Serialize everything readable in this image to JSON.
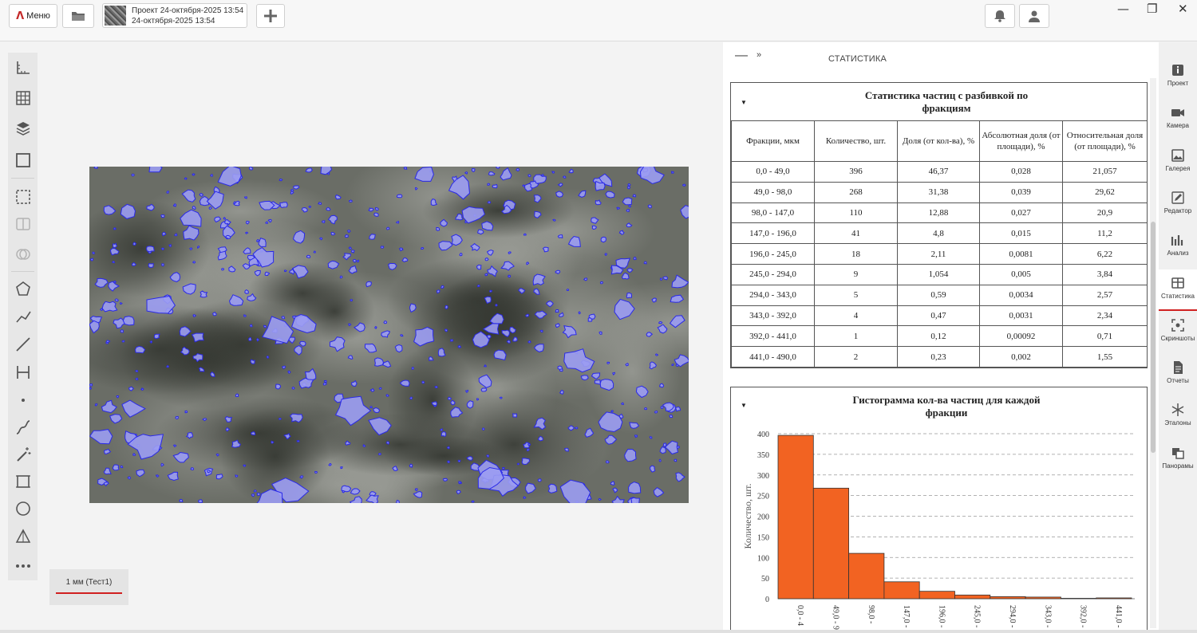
{
  "topbar": {
    "menu_label": "Меню",
    "project_line1": "Проект 24-октября-2025 13:54",
    "project_line2": "24-октября-2025 13:54",
    "icons": [
      "logo-icon",
      "folder-icon",
      "add-icon",
      "bell-icon",
      "user-icon"
    ]
  },
  "scale": {
    "label": "1 мм (Тест1)"
  },
  "panel": {
    "title": "СТАТИСТИКА"
  },
  "stats_table": {
    "title": "Статистика частиц с разбивкой по фракциям",
    "headers": [
      "Фракции, мкм",
      "Количество, шт.",
      "Доля (от кол-ва), %",
      "Абсолютная доля (от площади), %",
      "Относительная доля (от площади), %"
    ],
    "rows": [
      [
        "0,0 - 49,0",
        "396",
        "46,37",
        "0,028",
        "21,057"
      ],
      [
        "49,0 - 98,0",
        "268",
        "31,38",
        "0,039",
        "29,62"
      ],
      [
        "98,0 - 147,0",
        "110",
        "12,88",
        "0,027",
        "20,9"
      ],
      [
        "147,0 - 196,0",
        "41",
        "4,8",
        "0,015",
        "11,2"
      ],
      [
        "196,0 - 245,0",
        "18",
        "2,11",
        "0,0081",
        "6,22"
      ],
      [
        "245,0 - 294,0",
        "9",
        "1,054",
        "0,005",
        "3,84"
      ],
      [
        "294,0 - 343,0",
        "5",
        "0,59",
        "0,0034",
        "2,57"
      ],
      [
        "343,0 - 392,0",
        "4",
        "0,47",
        "0,0031",
        "2,34"
      ],
      [
        "392,0 - 441,0",
        "1",
        "0,12",
        "0,00092",
        "0,71"
      ],
      [
        "441,0 - 490,0",
        "2",
        "0,23",
        "0,002",
        "1,55"
      ]
    ]
  },
  "chart_data": {
    "type": "bar",
    "title": "Гистограмма кол-ва частиц для каждой фракции",
    "ylabel": "Количество, шт.",
    "xlabel": "",
    "categories": [
      "0,0 - 4",
      "49,0 - 9",
      "98,0 -",
      "147,0 -",
      "196,0 -",
      "245,0 -",
      "294,0 -",
      "343,0 -",
      "392,0 -",
      "441,0 -"
    ],
    "values": [
      396,
      268,
      110,
      41,
      18,
      9,
      5,
      4,
      1,
      2
    ],
    "ylim": [
      0,
      400
    ],
    "yticks": [
      0,
      50,
      100,
      150,
      200,
      250,
      300,
      350,
      400
    ],
    "grid": true,
    "bar_color": "#f26322"
  },
  "rightnav": [
    {
      "label": "Проект",
      "icon": "info-icon"
    },
    {
      "label": "Камера",
      "icon": "camera-icon"
    },
    {
      "label": "Галерея",
      "icon": "gallery-icon"
    },
    {
      "label": "Редактор",
      "icon": "editor-icon"
    },
    {
      "label": "Анализ",
      "icon": "analysis-icon"
    },
    {
      "label": "Статистика",
      "icon": "statistics-icon",
      "active": true
    },
    {
      "label": "Скриншоты",
      "icon": "screenshot-icon"
    },
    {
      "label": "Отчеты",
      "icon": "report-icon"
    },
    {
      "label": "Эталоны",
      "icon": "standards-icon"
    },
    {
      "label": "Панорамы",
      "icon": "panorama-icon"
    }
  ]
}
